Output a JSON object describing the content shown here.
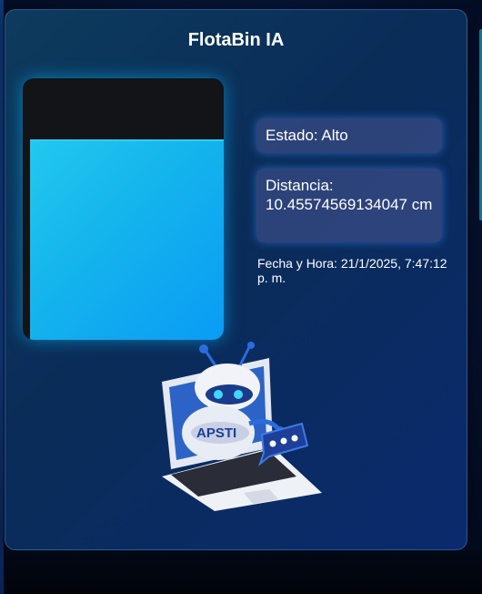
{
  "app": {
    "title": "FlotaBin IA"
  },
  "tank": {
    "fill_fraction": 0.76,
    "fill_color": "#14b3ec"
  },
  "status": {
    "text": "Estado: Alto"
  },
  "distance": {
    "text": "Distancia: 10.45574569134047 cm"
  },
  "timestamp": {
    "text": "Fecha y Hora: 21/1/2025, 7:47:12 p. m."
  },
  "illustration": {
    "icon": "robot-laptop-icon",
    "logo_text": "APSTI",
    "chat_icon": "chat-bubble-icon"
  },
  "colors": {
    "accent": "#22c8ee",
    "card_bg": "#0b2f5c",
    "info_bg": "#324880"
  }
}
